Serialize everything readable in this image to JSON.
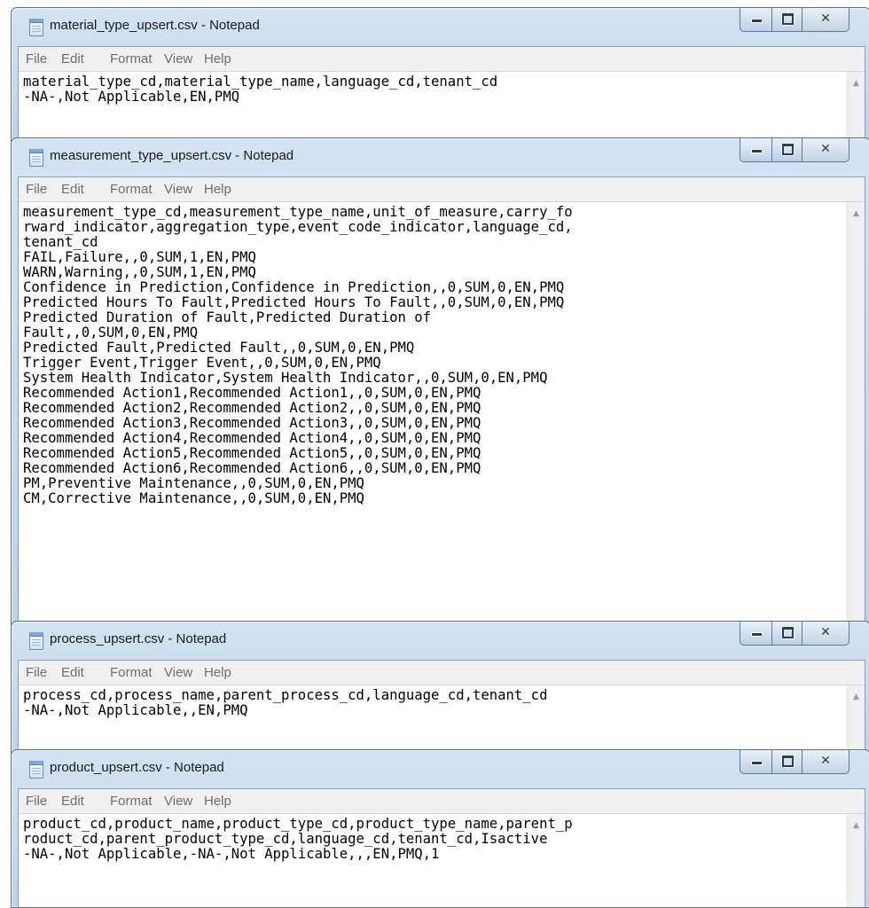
{
  "menu": [
    "File",
    "Edit",
    "Format",
    "View",
    "Help"
  ],
  "icons": {
    "app": "notepad-icon",
    "minimize": "minimize-icon",
    "maximize": "maximize-icon",
    "close": "close-icon",
    "scroll_up": "scroll-up-arrow-icon"
  },
  "colors": {
    "titlebar": "#c9dcf0",
    "menu_text": "#6d6d6d",
    "border": "#5a6f86"
  },
  "windows": [
    {
      "title": "material_type_upsert.csv - Notepad",
      "lines": [
        "material_type_cd,material_type_name,language_cd,tenant_cd",
        "-NA-,Not Applicable,EN,PMQ"
      ]
    },
    {
      "title": "measurement_type_upsert.csv - Notepad",
      "lines": [
        "measurement_type_cd,measurement_type_name,unit_of_measure,carry_fo",
        "rward_indicator,aggregation_type,event_code_indicator,language_cd,",
        "tenant_cd",
        "FAIL,Failure,,0,SUM,1,EN,PMQ",
        "WARN,Warning,,0,SUM,1,EN,PMQ",
        "Confidence in Prediction,Confidence in Prediction,,0,SUM,0,EN,PMQ",
        "Predicted Hours To Fault,Predicted Hours To Fault,,0,SUM,0,EN,PMQ",
        "Predicted Duration of Fault,Predicted Duration of",
        "Fault,,0,SUM,0,EN,PMQ",
        "Predicted Fault,Predicted Fault,,0,SUM,0,EN,PMQ",
        "Trigger Event,Trigger Event,,0,SUM,0,EN,PMQ",
        "System Health Indicator,System Health Indicator,,0,SUM,0,EN,PMQ",
        "Recommended Action1,Recommended Action1,,0,SUM,0,EN,PMQ",
        "Recommended Action2,Recommended Action2,,0,SUM,0,EN,PMQ",
        "Recommended Action3,Recommended Action3,,0,SUM,0,EN,PMQ",
        "Recommended Action4,Recommended Action4,,0,SUM,0,EN,PMQ",
        "Recommended Action5,Recommended Action5,,0,SUM,0,EN,PMQ",
        "Recommended Action6,Recommended Action6,,0,SUM,0,EN,PMQ",
        "PM,Preventive Maintenance,,0,SUM,0,EN,PMQ",
        "CM,Corrective Maintenance,,0,SUM,0,EN,PMQ"
      ]
    },
    {
      "title": "process_upsert.csv - Notepad",
      "lines": [
        "process_cd,process_name,parent_process_cd,language_cd,tenant_cd",
        "-NA-,Not Applicable,,EN,PMQ"
      ]
    },
    {
      "title": "product_upsert.csv - Notepad",
      "lines": [
        "product_cd,product_name,product_type_cd,product_type_name,parent_p",
        "roduct_cd,parent_product_type_cd,language_cd,tenant_cd,Isactive",
        "-NA-,Not Applicable,-NA-,Not Applicable,,,EN,PMQ,1"
      ]
    }
  ]
}
